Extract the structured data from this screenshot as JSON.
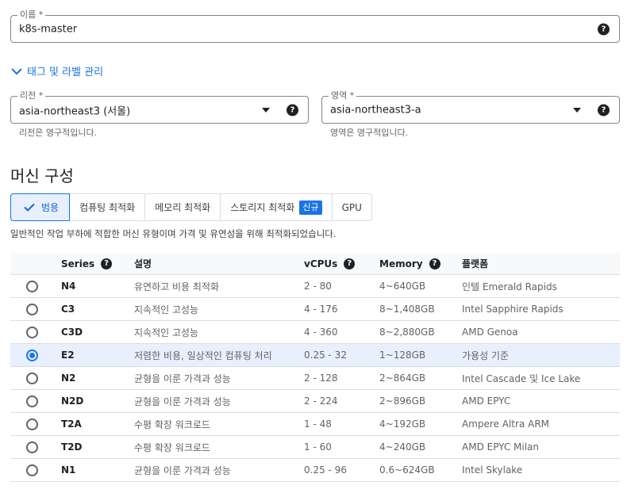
{
  "name_field": {
    "label": "이름 *",
    "value": "k8s-master"
  },
  "tags_link": {
    "label": "태그 및 라벨 관리"
  },
  "region_field": {
    "label": "리전 *",
    "value": "asia-northeast3 (서울)",
    "hint": "리전은 영구적입니다."
  },
  "zone_field": {
    "label": "영역 *",
    "value": "asia-northeast3-a",
    "hint": "영역은 영구적입니다."
  },
  "machine_config": {
    "title": "머신 구성",
    "tabs": [
      {
        "label": "범용",
        "active": true
      },
      {
        "label": "컴퓨팅 최적화"
      },
      {
        "label": "메모리 최적화"
      },
      {
        "label": "스토리지 최적화",
        "badge": "신규"
      },
      {
        "label": "GPU"
      }
    ],
    "description": "일반적인 작업 부하에 적합한 머신 유형이며 가격 및 유연성을 위해 최적화되었습니다."
  },
  "table": {
    "headers": {
      "series": "Series",
      "desc": "설명",
      "vcpus": "vCPUs",
      "memory": "Memory",
      "platform": "플랫폼"
    },
    "rows": [
      {
        "series": "N4",
        "desc": "유연하고 비용 최적화",
        "vcpus": "2 - 80",
        "memory": "4~640GB",
        "platform": "인텔 Emerald Rapids",
        "selected": false
      },
      {
        "series": "C3",
        "desc": "지속적인 고성능",
        "vcpus": "4 - 176",
        "memory": "8~1,408GB",
        "platform": "Intel Sapphire Rapids",
        "selected": false
      },
      {
        "series": "C3D",
        "desc": "지속적인 고성능",
        "vcpus": "4 - 360",
        "memory": "8~2,880GB",
        "platform": "AMD Genoa",
        "selected": false
      },
      {
        "series": "E2",
        "desc": "저렴한 비용, 일상적인 컴퓨팅 처리",
        "vcpus": "0.25 - 32",
        "memory": "1~128GB",
        "platform": "가용성 기준",
        "selected": true
      },
      {
        "series": "N2",
        "desc": "균형을 이룬 가격과 성능",
        "vcpus": "2 - 128",
        "memory": "2~864GB",
        "platform": "Intel Cascade 및 Ice Lake",
        "selected": false
      },
      {
        "series": "N2D",
        "desc": "균형을 이룬 가격과 성능",
        "vcpus": "2 - 224",
        "memory": "2~896GB",
        "platform": "AMD EPYC",
        "selected": false
      },
      {
        "series": "T2A",
        "desc": "수평 확장 워크로드",
        "vcpus": "1 - 48",
        "memory": "4~192GB",
        "platform": "Ampere Altra ARM",
        "selected": false
      },
      {
        "series": "T2D",
        "desc": "수평 확장 워크로드",
        "vcpus": "1 - 60",
        "memory": "4~240GB",
        "platform": "AMD EPYC Milan",
        "selected": false
      },
      {
        "series": "N1",
        "desc": "균형을 이룬 가격과 성능",
        "vcpus": "0.25 - 96",
        "memory": "0.6~624GB",
        "platform": "Intel Skylake",
        "selected": false
      }
    ]
  },
  "icons": {
    "help": "?"
  },
  "colors": {
    "accent": "#1a73e8",
    "selected_row": "#e8f0fe"
  }
}
